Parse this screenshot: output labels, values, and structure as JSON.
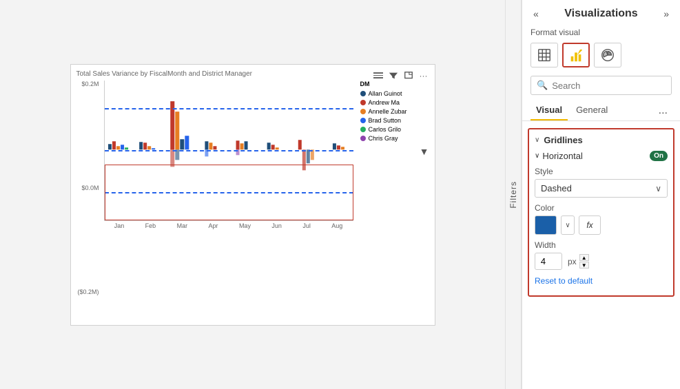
{
  "panel": {
    "title": "Visualizations",
    "collapse_left": "«",
    "collapse_right": "»",
    "format_visual_label": "Format visual",
    "search_placeholder": "Search",
    "tabs": [
      {
        "label": "Visual",
        "active": true
      },
      {
        "label": "General",
        "active": false
      }
    ],
    "tab_more": "...",
    "sections": {
      "gridlines": {
        "title": "Gridlines",
        "subsections": {
          "horizontal": {
            "title": "Horizontal",
            "toggle_label": "On",
            "fields": {
              "style_label": "Style",
              "style_value": "Dashed",
              "color_label": "Color",
              "color_hex": "#1a5fa8",
              "width_label": "Width",
              "width_value": "4",
              "width_unit": "px"
            }
          }
        },
        "reset_label": "Reset to default"
      }
    }
  },
  "chart": {
    "title": "Total Sales Variance by FiscalMonth and District Manager",
    "filter_icon": "⊞",
    "yaxis_labels": [
      "$0.2M",
      "$0.0M",
      "($0.2M)"
    ],
    "xaxis_labels": [
      "Jan",
      "Feb",
      "Mar",
      "Apr",
      "May",
      "Jun",
      "Jul",
      "Aug"
    ],
    "legend": {
      "title": "DM",
      "items": [
        {
          "label": "Allan Guinot",
          "color": "#1f4e79"
        },
        {
          "label": "Andrew Ma",
          "color": "#c0392b"
        },
        {
          "label": "Annelle Zubar",
          "color": "#e67e22"
        },
        {
          "label": "Brad Sutton",
          "color": "#2563eb"
        },
        {
          "label": "Carlos Grilo",
          "color": "#27ae60"
        },
        {
          "label": "Chris Gray",
          "color": "#8e44ad"
        }
      ]
    }
  },
  "filters": {
    "label": "Filters"
  }
}
